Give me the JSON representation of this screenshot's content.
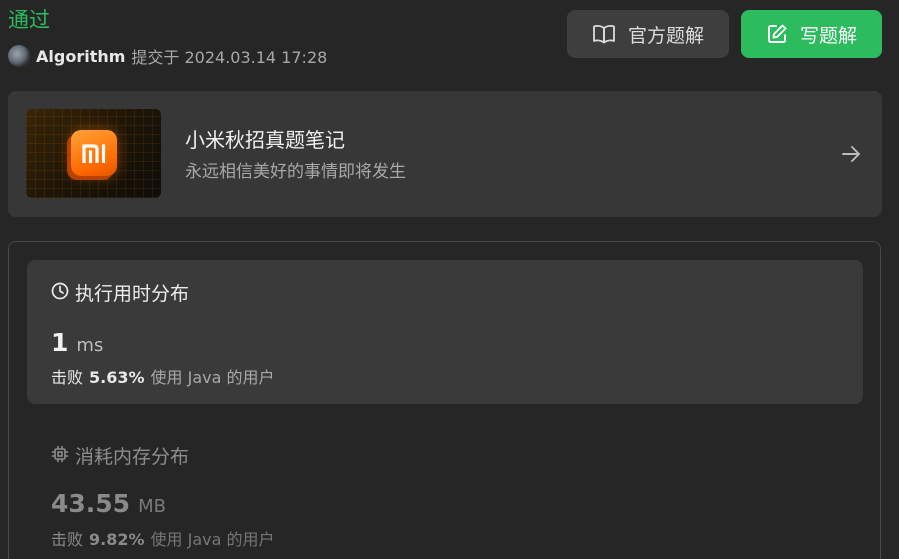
{
  "header": {
    "status": "通过",
    "username": "Algorithm",
    "submitted_at": "提交于 2024.03.14 17:28"
  },
  "actions": {
    "official_solution_label": "官方题解",
    "write_solution_label": "写题解"
  },
  "promo": {
    "title": "小米秋招真题笔记",
    "subtitle": "永远相信美好的事情即将发生",
    "logo_text": "mi"
  },
  "runtime": {
    "heading": "执行用时分布",
    "value": "1",
    "unit": "ms",
    "beats_label": "击败",
    "beats_pct": "5.63%",
    "beats_rest": "使用 Java 的用户"
  },
  "memory": {
    "heading": "消耗内存分布",
    "value": "43.55",
    "unit": "MB",
    "beats_label": "击败",
    "beats_pct": "9.82%",
    "beats_rest": "使用 Java 的用户"
  },
  "icons": {
    "official": "book-open-icon",
    "write": "edit-icon",
    "promo_arrow": "arrow-right-icon",
    "runtime": "clock-icon",
    "memory": "chip-icon"
  },
  "colors": {
    "accepted": "#2cbb5d",
    "background": "#262626",
    "card": "#373737",
    "brand_orange": "#ff6a00"
  }
}
